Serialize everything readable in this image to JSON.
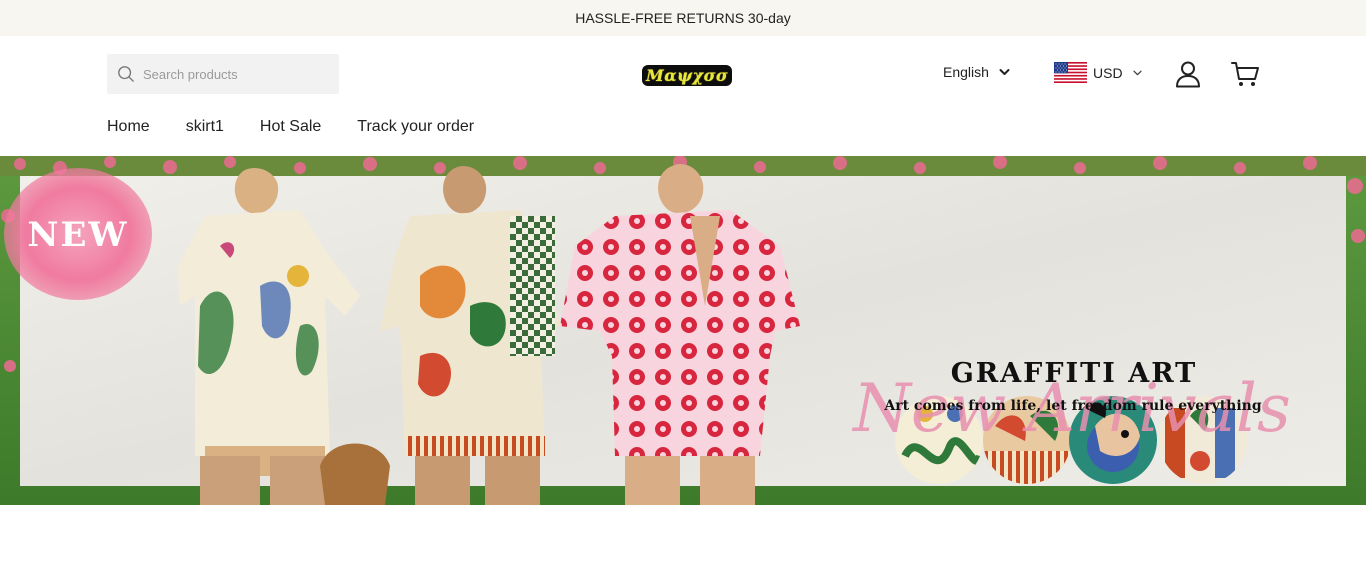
{
  "announcement": {
    "text": "HASSLE-FREE RETURNS 30-day"
  },
  "header": {
    "search": {
      "placeholder": "Search products"
    },
    "logo": {
      "text": "Μαψχσσ"
    },
    "language": {
      "selected": "English"
    },
    "currency": {
      "selected": "USD"
    }
  },
  "nav": {
    "items": [
      {
        "label": "Home"
      },
      {
        "label": "skirt1"
      },
      {
        "label": "Hot Sale"
      },
      {
        "label": "Track your order"
      }
    ]
  },
  "banner": {
    "badge": "NEW",
    "headline": "GRAFFITI ART",
    "tagline": "Art comes from life, let freedom rule everything",
    "script": "New Arrivals"
  },
  "colors": {
    "announcement_bg": "#f8f6f0",
    "search_bg": "#f2f2f2",
    "logo_bg": "#0d0d0d",
    "logo_text": "#e8e53b",
    "badge_pink": "#f07ba0",
    "script_pink": "#e890b0"
  }
}
